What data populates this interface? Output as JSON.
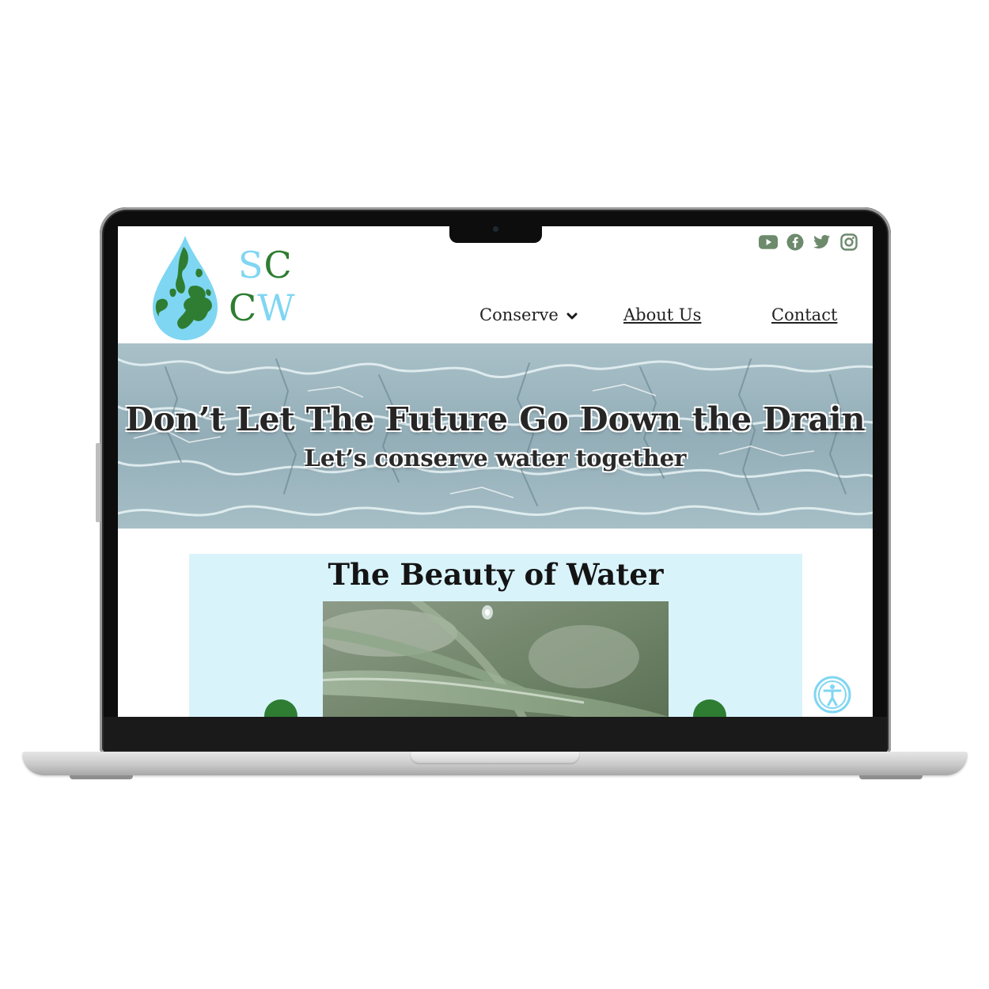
{
  "site": {
    "logo": {
      "name": "SCCW",
      "line1": [
        "S",
        "C"
      ],
      "line2": [
        "C",
        "W"
      ],
      "colors": {
        "light_blue": "#7fd6f2",
        "green": "#2e7d32"
      }
    },
    "social_icons": [
      "youtube-icon",
      "facebook-icon",
      "twitter-icon",
      "instagram-icon"
    ],
    "social_color": "#6d8a6c",
    "nav": {
      "conserve": "Conserve",
      "about": "About Us",
      "contact": "Contact"
    }
  },
  "hero": {
    "title": "Don’t Let The Future Go Down the Drain",
    "subtitle": "Let’s conserve water together"
  },
  "gallery": {
    "title": "The Beauty of Water",
    "background": "#d9f3fb",
    "arrow_color": "#2e7d32"
  },
  "accessibility": {
    "icon": "accessibility-icon",
    "color": "#7fd6f2"
  }
}
